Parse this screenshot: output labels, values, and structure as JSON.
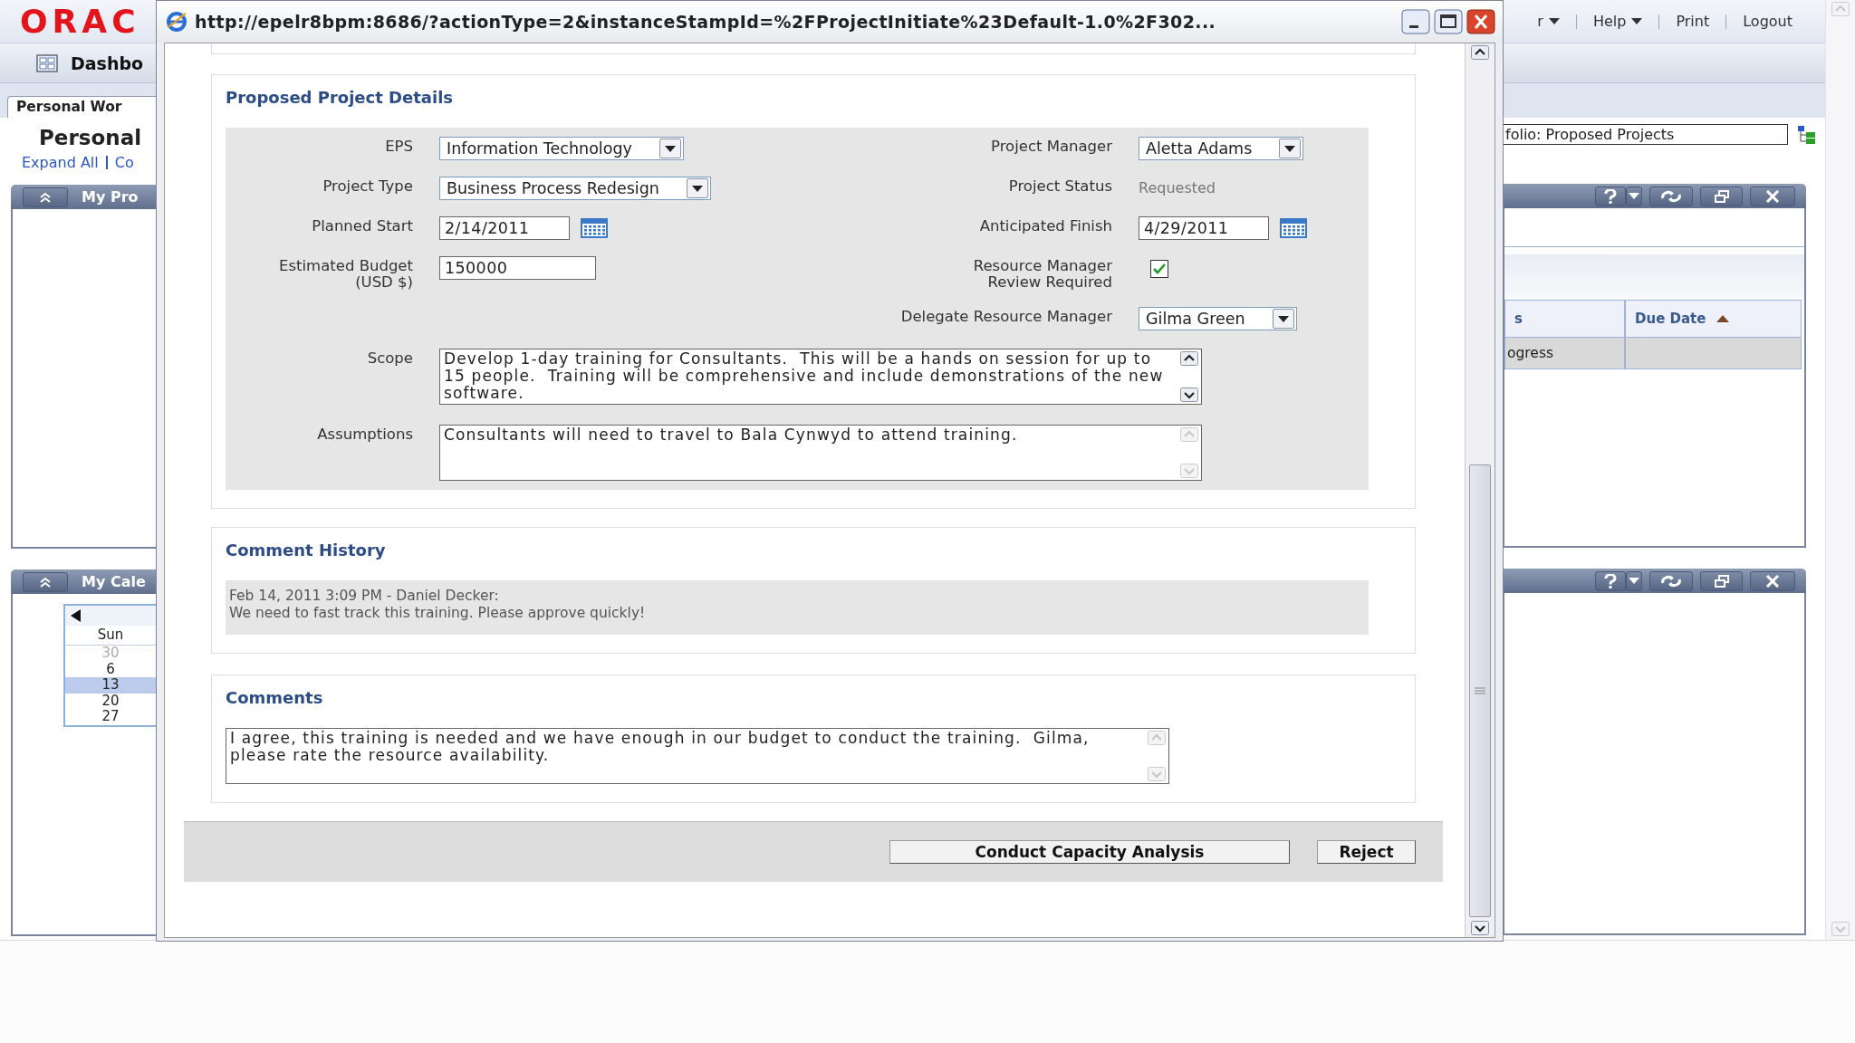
{
  "background": {
    "logo": "ORAC",
    "top_menu": [
      {
        "label": "r",
        "dropdown": true
      },
      {
        "label": "Help",
        "dropdown": true
      },
      {
        "label": "Print",
        "dropdown": false
      },
      {
        "label": "Logout",
        "dropdown": false
      }
    ],
    "nav_tab": "Dashbo",
    "page_tab": "Personal Wor",
    "page_title": "Personal",
    "links": [
      "Expand All",
      "Co"
    ],
    "portlets": [
      {
        "title": "My Pro"
      },
      {
        "title": "My Cale"
      }
    ],
    "calendar": {
      "day_header": "Sun",
      "days": [
        {
          "label": "30",
          "muted": true,
          "selected": false
        },
        {
          "label": "6",
          "muted": false,
          "selected": false
        },
        {
          "label": "13",
          "muted": false,
          "selected": true
        },
        {
          "label": "20",
          "muted": false,
          "selected": false
        },
        {
          "label": "27",
          "muted": false,
          "selected": false
        }
      ]
    },
    "filter_field": {
      "value": "folio: Proposed Projects"
    },
    "table": {
      "columns": [
        {
          "label": "s",
          "sorted": false
        },
        {
          "label": "Due Date",
          "sorted": true
        }
      ],
      "rows": [
        {
          "cells": [
            "ogress"
          ]
        }
      ]
    }
  },
  "popup": {
    "title": "http://epelr8bpm:8686/?actionType=2&instanceStampId=%2FProjectInitiate%23Default-1.0%2F302...",
    "details": {
      "title": "Proposed Project Details",
      "rows": [
        {
          "left": {
            "label": "EPS",
            "kind": "select",
            "value": "Information Technology"
          },
          "right": {
            "label": "Project Manager",
            "kind": "select",
            "value": "Aletta Adams"
          }
        },
        {
          "left": {
            "label": "Project Type",
            "kind": "select",
            "value": "Business Process Redesign"
          },
          "right": {
            "label": "Project Status",
            "kind": "readonly",
            "value": "Requested"
          }
        },
        {
          "left": {
            "label": "Planned Start",
            "kind": "date",
            "value": "2/14/2011"
          },
          "right": {
            "label": "Anticipated Finish",
            "kind": "date",
            "value": "4/29/2011"
          }
        },
        {
          "left": {
            "label": "Estimated Budget\n(USD $)",
            "kind": "text",
            "value": "150000"
          },
          "right": {
            "label": "Resource Manager\nReview Required",
            "kind": "checkbox",
            "checked": true
          }
        },
        {
          "right": {
            "label": "Delegate Resource Manager",
            "kind": "select",
            "value": "Gilma Green"
          }
        }
      ],
      "text_areas": [
        {
          "label": "Scope",
          "value": "Develop 1-day training for Consultants.  This will be a hands on session for up to 15 people.  Training will be comprehensive and include demonstrations of the new software.",
          "scrollable": true
        },
        {
          "label": "Assumptions",
          "value": "Consultants will need to travel to Bala Cynwyd to attend training.",
          "scrollable": false
        }
      ]
    },
    "history": {
      "title": "Comment History",
      "entries": [
        {
          "header": "Feb 14, 2011 3:09 PM - Daniel Decker:",
          "text": "We need to fast track this training.  Please approve quickly!"
        }
      ]
    },
    "comments": {
      "title": "Comments",
      "value": "I agree, this training is needed and we have enough in our budget to conduct the training.  Gilma, please rate the resource availability.",
      "scrollable": false
    },
    "buttons": [
      "Conduct Capacity Analysis",
      "Reject"
    ]
  }
}
